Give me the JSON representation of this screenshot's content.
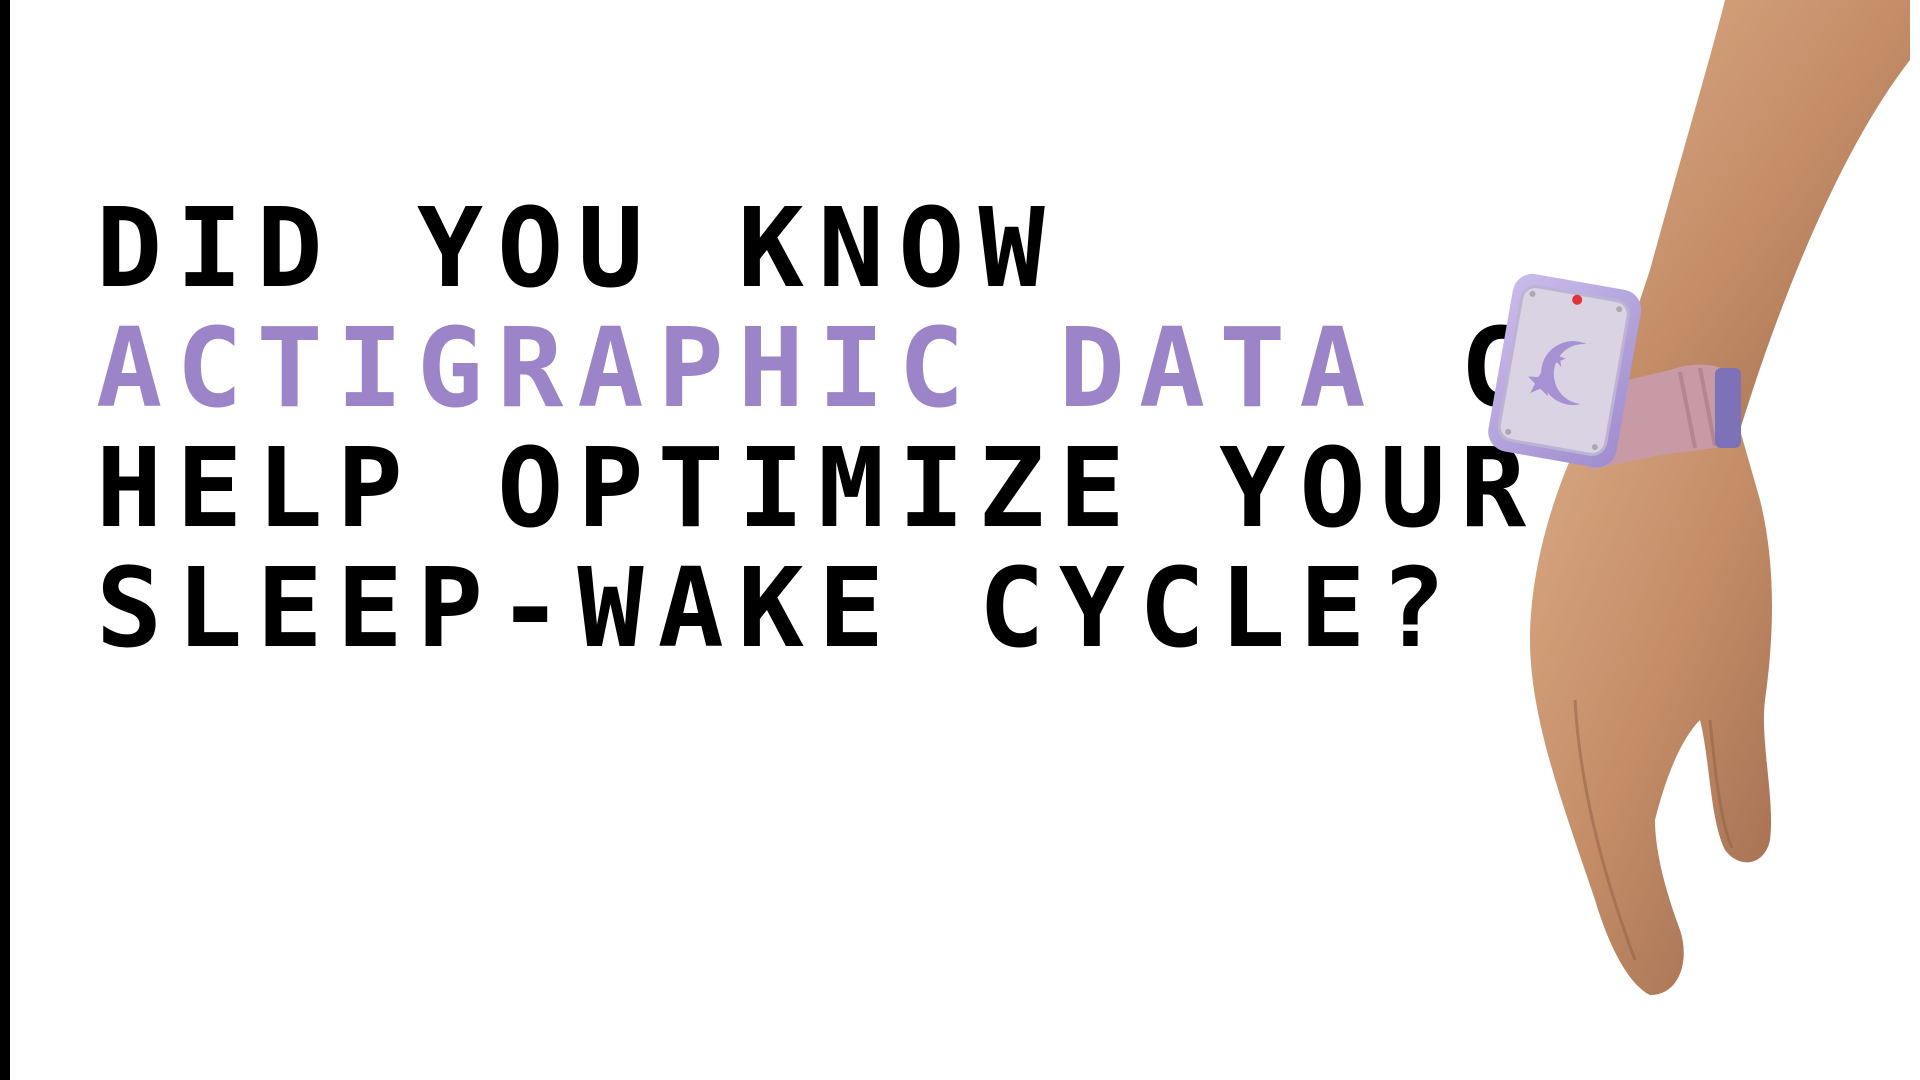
{
  "headline": {
    "line1": "DID YOU KNOW",
    "line2_accent": "ACTIGRAPHIC DATA",
    "line2_rest": " CA",
    "line3": "HELP OPTIMIZE YOUR",
    "line4": "SLEEP-WAKE CYCLE?"
  },
  "colors": {
    "background": "#ffffff",
    "text": "#000000",
    "accent": "#9b84c8",
    "device": "#b7a6dd",
    "strap": "#c89aa6",
    "skin": "#c99672"
  },
  "icons": {
    "device_face": "moon-stars-icon"
  }
}
